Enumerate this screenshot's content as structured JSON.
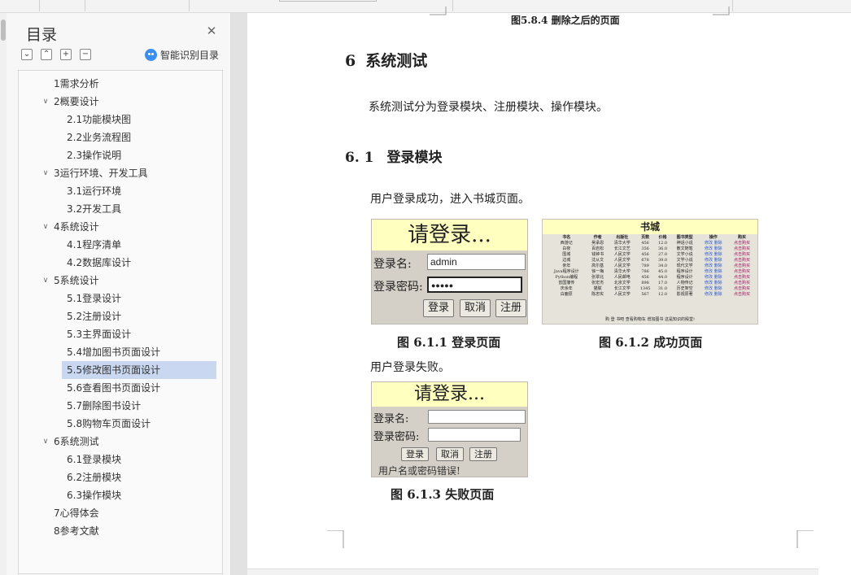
{
  "toc": {
    "title": "目录",
    "ai_label": "智能识别目录",
    "tools": [
      "⌄",
      "⌃",
      "+",
      "−"
    ],
    "items": [
      {
        "label": "1需求分析",
        "level": 1,
        "expandable": false
      },
      {
        "label": "2概要设计",
        "level": 1,
        "expandable": true
      },
      {
        "label": "2.1功能模块图",
        "level": 2
      },
      {
        "label": "2.2业务流程图",
        "level": 2
      },
      {
        "label": "2.3操作说明",
        "level": 2
      },
      {
        "label": "3运行环境、开发工具",
        "level": 1,
        "expandable": true
      },
      {
        "label": "3.1运行环境",
        "level": 2
      },
      {
        "label": "3.2开发工具",
        "level": 2
      },
      {
        "label": "4系统设计",
        "level": 1,
        "expandable": true
      },
      {
        "label": "4.1程序清单",
        "level": 2
      },
      {
        "label": "4.2数据库设计",
        "level": 2
      },
      {
        "label": "5系统设计",
        "level": 1,
        "expandable": true
      },
      {
        "label": "5.1登录设计",
        "level": 2
      },
      {
        "label": "5.2注册设计",
        "level": 2
      },
      {
        "label": "5.3主界面设计",
        "level": 2
      },
      {
        "label": "5.4增加图书页面设计",
        "level": 2
      },
      {
        "label": "5.5修改图书页面设计",
        "level": 2,
        "selected": true
      },
      {
        "label": "5.6查看图书页面设计",
        "level": 2
      },
      {
        "label": "5.7删除图书设计",
        "level": 2
      },
      {
        "label": "5.8购物车页面设计",
        "level": 2
      },
      {
        "label": "6系统测试",
        "level": 1,
        "expandable": true
      },
      {
        "label": "6.1登录模块",
        "level": 2
      },
      {
        "label": "6.2注册模块",
        "level": 2
      },
      {
        "label": "6.3操作模块",
        "level": 2
      },
      {
        "label": "7心得体会",
        "level": 1,
        "expandable": false
      },
      {
        "label": "8参考文献",
        "level": 1,
        "expandable": false
      }
    ]
  },
  "doc": {
    "top_caption": "图5.8.4  删除之后的页面",
    "h1_num": "6",
    "h1_text": "系统测试",
    "intro": "系统测试分为登录模块、注册模块、操作模块。",
    "h2_num": "6. 1",
    "h2_text": "登录模块",
    "success_text": "用户登录成功，进入书城页面。",
    "fig1_caption": "图 6.1.1 登录页面",
    "fig2_caption": "图 6.1.2 成功页面",
    "fail_text": "用户登录失败。",
    "fig3_caption": "图 6.1.3 失败页面"
  },
  "login_mock": {
    "banner": "请登录...",
    "username_label": "登录名:",
    "password_label": "登录密码:",
    "username_value": "admin",
    "password_value": "●●●●●",
    "btn_login": "登录",
    "btn_cancel": "取消",
    "btn_register": "注册",
    "error_text": "用户名或密码错误!"
  },
  "store_mock": {
    "title": "书城",
    "headers": [
      "书名",
      "作者",
      "出版社",
      "页数",
      "价格",
      "图书类型",
      "操作",
      "购买"
    ],
    "rows": [
      [
        "西游记",
        "吴承恩",
        "清华大学",
        "456",
        "12.0",
        "神话小说",
        "修改 删除",
        "点击购买"
      ],
      [
        "白夜",
        "百岩松",
        "长江文艺",
        "356",
        "36.0",
        "散文随笔",
        "修改 删除",
        "点击购买"
      ],
      [
        "围城",
        "钱钟书",
        "人民文学",
        "456",
        "27.0",
        "文学小说",
        "修改 删除",
        "点击购买"
      ],
      [
        "边城",
        "沈从文",
        "人民文学",
        "678",
        "39.0",
        "文学小说",
        "修改 删除",
        "点击购买"
      ],
      [
        "亲年",
        "高尔基",
        "人民文学",
        "789",
        "34.0",
        "现代文学",
        "修改 删除",
        "点击购买"
      ],
      [
        "Java程序设计",
        "徐一梅",
        "清华大学",
        "786",
        "45.0",
        "程序设计",
        "修改 删除",
        "点击购买"
      ],
      [
        "Python编程",
        "张翠北",
        "人民邮电",
        "456",
        "44.0",
        "程序设计",
        "修改 删除",
        "点击购买"
      ],
      [
        "曾国藩传",
        "张宏杰",
        "北京文学",
        "898",
        "17.0",
        "人物传记",
        "修改 删除",
        "点击购买"
      ],
      [
        "庆余年",
        "猫腻",
        "长江文学",
        "1345",
        "31.0",
        "历史架空",
        "修改 删除",
        "点击购买"
      ],
      [
        "白鹿原",
        "陈忠实",
        "人民文学",
        "567",
        "12.0",
        "影视原著",
        "修改 删除",
        "点击购买"
      ]
    ],
    "footer": "购 登 书吧    查看购物车    增加图书    这是知识的殿堂!"
  }
}
